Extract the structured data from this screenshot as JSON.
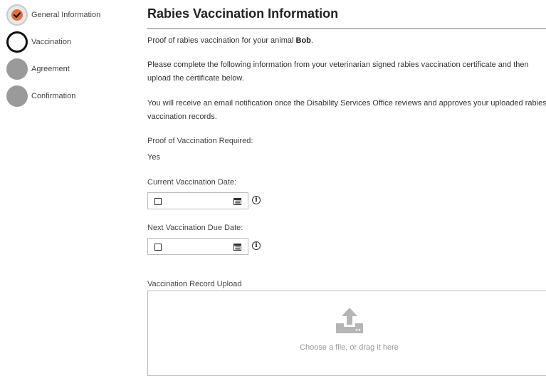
{
  "steps": [
    {
      "label": "General Information",
      "state": "done"
    },
    {
      "label": "Vaccination",
      "state": "current"
    },
    {
      "label": "Agreement",
      "state": "todo"
    },
    {
      "label": "Confirmation",
      "state": "todo"
    }
  ],
  "page": {
    "title": "Rabies Vaccination Information",
    "intro_prefix": "Proof of rabies vaccination for your animal ",
    "animal_name": "Bob",
    "intro_suffix": ".",
    "instructions_line1": "Please complete the following information from your veterinarian signed rabies vaccination certificate and then",
    "instructions_line2": "upload the certificate below.",
    "notice_line1": "You will receive an email notification once the Disability Services Office reviews and approves your uploaded rabies",
    "notice_line2": "vaccination records."
  },
  "proof_required": {
    "label": "Proof of Vaccination Required:",
    "value": "Yes"
  },
  "current_date": {
    "label": "Current Vaccination Date:",
    "value": ""
  },
  "next_due_date": {
    "label": "Next Vaccination Due Date:",
    "value": ""
  },
  "upload": {
    "label": "Vaccination Record Upload",
    "hint": "Choose a file, or drag it here"
  },
  "colors": {
    "accent": "#e2703a",
    "todo": "#9a9a9a",
    "current_border": "#111111"
  },
  "icons": {
    "done": "check-icon",
    "date": "calendar-icon",
    "info": "info-icon",
    "upload": "upload-icon"
  }
}
